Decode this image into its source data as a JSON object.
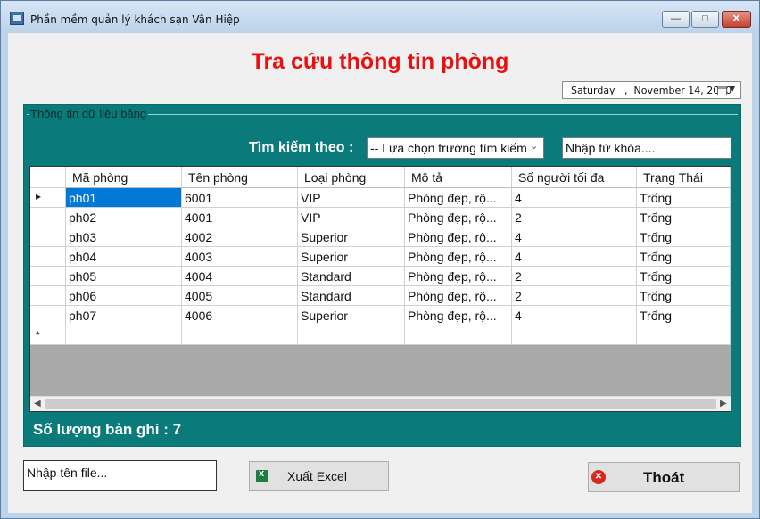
{
  "window": {
    "title": "Phần mềm quản lý khách sạn Vân Hiệp"
  },
  "form": {
    "title": "Tra cứu thông tin phòng",
    "date": "Saturday   ,  November 14, 2020"
  },
  "group": {
    "title": "Thông tin dữ liệu  bảng",
    "search_label": "Tìm kiếm theo :",
    "search_field": "-- Lựa chọn trường tìm kiếm",
    "keyword_placeholder": "Nhập từ khóa...."
  },
  "table": {
    "columns": [
      "Mã phòng",
      "Tên phòng",
      "Loại phòng",
      "Mô tả",
      "Số người tối đa",
      "Trạng Thái"
    ],
    "rows": [
      [
        "ph01",
        "6001",
        "VIP",
        "Phòng đẹp, rộ...",
        "4",
        "Trống"
      ],
      [
        "ph02",
        "4001",
        "VIP",
        "Phòng đẹp, rộ...",
        "2",
        "Trống"
      ],
      [
        "ph03",
        "4002",
        "Superior",
        "Phòng đẹp, rộ...",
        "4",
        "Trống"
      ],
      [
        "ph04",
        "4003",
        "Superior",
        "Phòng đẹp, rộ...",
        "4",
        "Trống"
      ],
      [
        "ph05",
        "4004",
        "Standard",
        "Phòng đẹp, rộ...",
        "2",
        "Trống"
      ],
      [
        "ph06",
        "4005",
        "Standard",
        "Phòng đẹp, rộ...",
        "2",
        "Trống"
      ],
      [
        "ph07",
        "4006",
        "Superior",
        "Phòng đẹp, rộ...",
        "4",
        "Trống"
      ]
    ],
    "current_row_marker": "▸",
    "new_row_marker": "*"
  },
  "record_count": "Số lượng bản ghi : 7",
  "footer": {
    "filename_placeholder": "Nhập tên file...",
    "export_label": "Xuất Excel",
    "exit_label": "Thoát"
  },
  "icons": {
    "app": "app-icon",
    "calendar": "calendar-icon",
    "excel": "excel-icon",
    "exit": "exit-icon"
  }
}
